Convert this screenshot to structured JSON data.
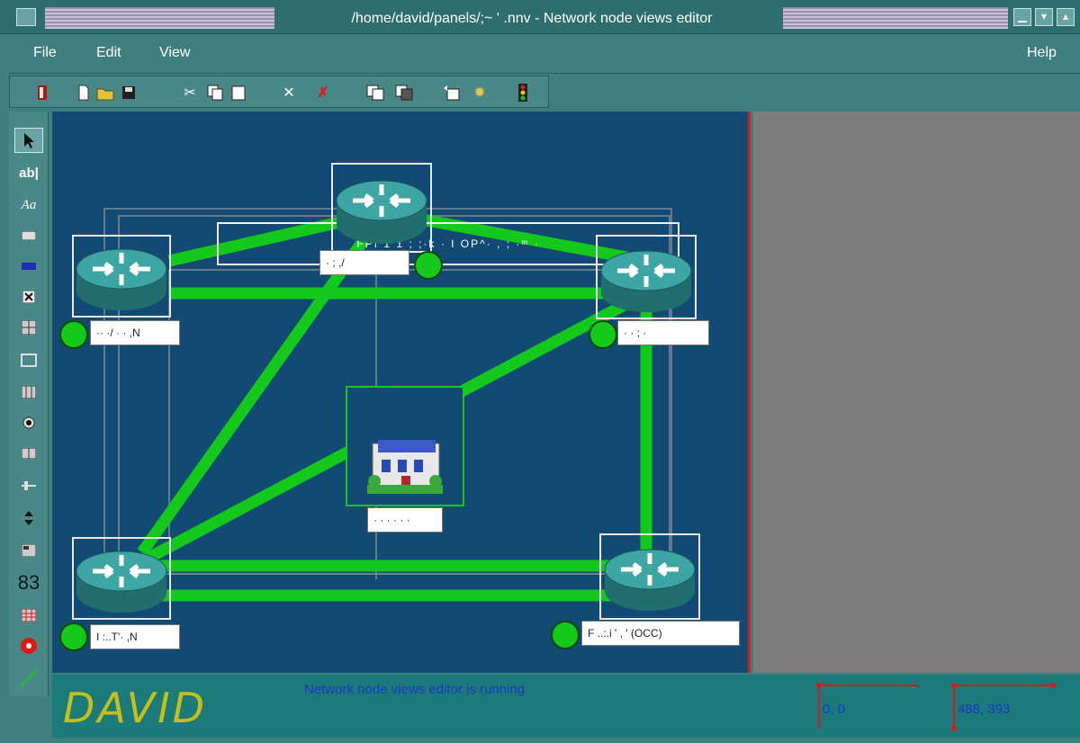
{
  "window": {
    "title": "/home/david/panels/;~ ' .nnv - Network node views editor",
    "sys_buttons": [
      "▁",
      "▾",
      "▴"
    ]
  },
  "menu": {
    "file": "File",
    "edit": "Edit",
    "view": "View",
    "help": "Help"
  },
  "toolbar_icons": [
    "exit-icon",
    "new-file-icon",
    "open-folder-icon",
    "save-icon",
    "cut-icon",
    "copy-icon",
    "paste-icon",
    "delete-icon",
    "delete-all-icon",
    "duplicate-icon",
    "stack-icon",
    "undo-icon",
    "settings-icon",
    "traffic-light-icon"
  ],
  "palette": {
    "text_tool": "ab|",
    "font_tool": "Aa",
    "counter_tool": "83"
  },
  "canvas": {
    "title_text": "FPI 1 1  ;  ;·k  ·  I OP^·  ,  ;  ·ᵐ  ·",
    "nodes": [
      {
        "label": "· ;  ,/",
        "icon": "router-icon"
      },
      {
        "label": "·· ·/ · · ,N",
        "icon": "router-icon"
      },
      {
        "label": "·  ·  ;  ·",
        "icon": "router-icon"
      },
      {
        "label": "· ·  ·  · · ·",
        "icon": "building-icon"
      },
      {
        "label": "I :..T'· ,N",
        "icon": "router-icon"
      },
      {
        "label": "F ..:.i ' , ' (OCC)",
        "icon": "router-icon"
      }
    ]
  },
  "status": {
    "logo": "DAVID",
    "message": "Network node views editor is running",
    "coord_a": "0, 0",
    "coord_b": "488, 393"
  },
  "colors": {
    "link": "#14c81c",
    "canvas": "#124a73",
    "accent": "#d61c1c",
    "router": "#2f8e8e"
  }
}
